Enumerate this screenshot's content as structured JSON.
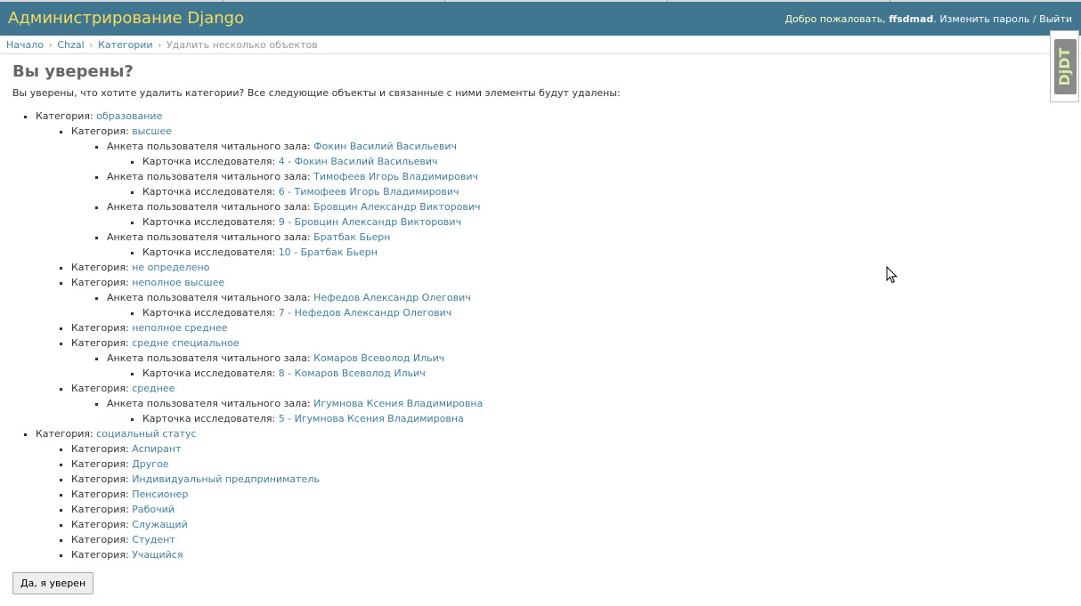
{
  "header": {
    "site_title": "Администрирование Django",
    "welcome_text": "Добро пожаловать,",
    "username": "ffsdmad",
    "change_password": "Изменить пароль",
    "separator": "/",
    "logout": "Выйти"
  },
  "breadcrumbs": {
    "items": [
      "Начало",
      "Chzal",
      "Категории"
    ],
    "current": "Удалить несколько объектов",
    "separator": "›"
  },
  "debug_toolbar": {
    "label": "DjDT"
  },
  "page": {
    "title": "Вы уверены?",
    "question": "Вы уверены, что хотите удалить категории? Все следующие объекты и связанные с ними элементы будут удалены:",
    "confirm_button": "Да, я уверен"
  },
  "labels": {
    "category": "Категория:",
    "reader_form": "Анкета пользователя читального зала:",
    "researcher_card": "Карточка исследователя:"
  },
  "tree": {
    "education": "образование",
    "higher": "высшее",
    "fokin_form": "Фокин Василий Васильевич",
    "fokin_card": "4 - Фокин Василий Васильевич",
    "timofeev_form": "Тимофеев Игорь Владимирович",
    "timofeev_card": "6 - Тимофеев Игорь Владимирович",
    "brovtsin_form": "Бровцин Александр Викторович",
    "brovtsin_card": "9 - Бровцин Александр Викторович",
    "bratbak_form": "Братбак Бьерн",
    "bratbak_card": "10 - Братбак Бьерн",
    "undefined": "не определено",
    "incomplete_higher": "неполное высшее",
    "nefedov_form": "Нефедов Александр Олегович",
    "nefedov_card": "7 - Нефедов Александр Олегович",
    "incomplete_secondary": "неполное среднее",
    "secondary_special": "средне специальное",
    "komarov_form": "Комаров Всеволод Ильич",
    "komarov_card": "8 - Комаров Всеволод Ильич",
    "secondary": "среднее",
    "igumnova_form": "Игумнова Ксения Владимировна",
    "igumnova_card": "5 - Игумнова Ксения Владимировна",
    "social_status": "социальный статус",
    "aspirant": "Аспирант",
    "other": "Другое",
    "entrepreneur": "Индивидуальный предприниматель",
    "pensioner": "Пенсионер",
    "worker": "Рабочий",
    "employee": "Служащий",
    "student": "Студент",
    "pupil": "Учащийся"
  },
  "colors": {
    "header_bg": "#417690",
    "branding": "#f5dd5d",
    "link": "#447e9b"
  }
}
